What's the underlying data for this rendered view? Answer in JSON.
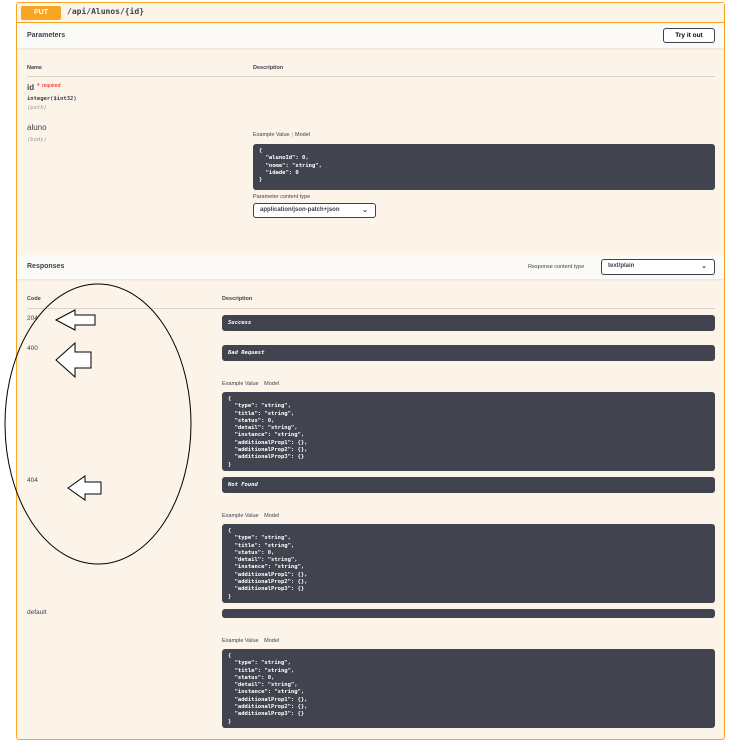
{
  "operation": {
    "method": "PUT",
    "path": "/api/Alunos/{id}"
  },
  "parameters": {
    "title": "Parameters",
    "try_button": "Try it out",
    "col_name": "Name",
    "col_description": "Description",
    "items": [
      {
        "name": "id",
        "required_star": "*",
        "required_label": "required",
        "type": "integer($int32)",
        "in": "(path)"
      },
      {
        "name": "aluno",
        "in": "(body)"
      }
    ],
    "example_tab": "Example Value",
    "model_tab": "Model",
    "example_body": "{\n  \"alunoId\": 0,\n  \"nome\": \"string\",\n  \"idade\": 0\n}",
    "content_type_label": "Parameter content type",
    "content_type_value": "application/json-patch+json"
  },
  "responses": {
    "title": "Responses",
    "content_type_label": "Response content type",
    "content_type_value": "text/plain",
    "col_code": "Code",
    "col_description": "Description",
    "example_tab": "Example Value",
    "model_tab": "Model",
    "items": [
      {
        "code": "204",
        "description": "Success"
      },
      {
        "code": "400",
        "description": "Bad Request",
        "example": "{\n  \"type\": \"string\",\n  \"title\": \"string\",\n  \"status\": 0,\n  \"detail\": \"string\",\n  \"instance\": \"string\",\n  \"additionalProp1\": {},\n  \"additionalProp2\": {},\n  \"additionalProp3\": {}\n}"
      },
      {
        "code": "404",
        "description": "Not Found",
        "example": "{\n  \"type\": \"string\",\n  \"title\": \"string\",\n  \"status\": 0,\n  \"detail\": \"string\",\n  \"instance\": \"string\",\n  \"additionalProp1\": {},\n  \"additionalProp2\": {},\n  \"additionalProp3\": {}\n}"
      },
      {
        "code": "default",
        "description": "",
        "example": "{\n  \"type\": \"string\",\n  \"title\": \"string\",\n  \"status\": 0,\n  \"detail\": \"string\",\n  \"instance\": \"string\",\n  \"additionalProp1\": {},\n  \"additionalProp2\": {},\n  \"additionalProp3\": {}\n}"
      }
    ]
  },
  "annotations": {
    "shapes": [
      "ellipse-outline",
      "arrow-left-icon",
      "arrow-left-icon",
      "arrow-left-icon"
    ]
  },
  "colors": {
    "put_accent": "#f6a623",
    "block_background": "#fcf4e8",
    "code_background": "#41444e"
  }
}
